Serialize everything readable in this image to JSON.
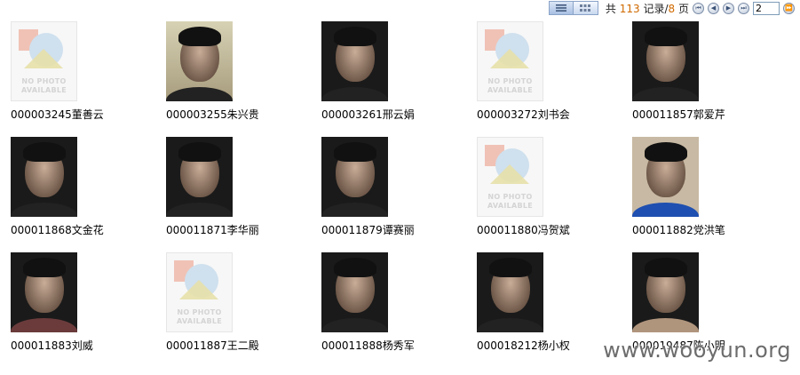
{
  "pager": {
    "prefix": "共",
    "total": "113",
    "records_label": "记录/",
    "pages": "8",
    "pages_label": "页",
    "current_page": "2",
    "nav": {
      "first": "⏮",
      "prev": "◀",
      "next": "▶",
      "last": "⏭",
      "go": "⏩"
    }
  },
  "no_photo_text": [
    "NO PHOTO",
    "AVAILABLE"
  ],
  "records": [
    {
      "caption": "000003245董善云",
      "photo": "none"
    },
    {
      "caption": "000003255朱兴贵",
      "photo": "light"
    },
    {
      "caption": "000003261邢云娟",
      "photo": "dark"
    },
    {
      "caption": "000003272刘书会",
      "photo": "none"
    },
    {
      "caption": "000011857郭爱芹",
      "photo": "dark"
    },
    {
      "caption": "000011868文金花",
      "photo": "dark"
    },
    {
      "caption": "000011871李华丽",
      "photo": "dark"
    },
    {
      "caption": "000011879谭赛丽",
      "photo": "dark"
    },
    {
      "caption": "000011880冯贺斌",
      "photo": "none"
    },
    {
      "caption": "000011882党洪笔",
      "photo": "blue"
    },
    {
      "caption": "000011883刘威",
      "photo": "red"
    },
    {
      "caption": "000011887王二殿",
      "photo": "none"
    },
    {
      "caption": "000011888杨秀军",
      "photo": "dark"
    },
    {
      "caption": "000018212杨小权",
      "photo": "dark"
    },
    {
      "caption": "000019487陈小明",
      "photo": "bare"
    }
  ],
  "watermark": "www.wooyun.org"
}
